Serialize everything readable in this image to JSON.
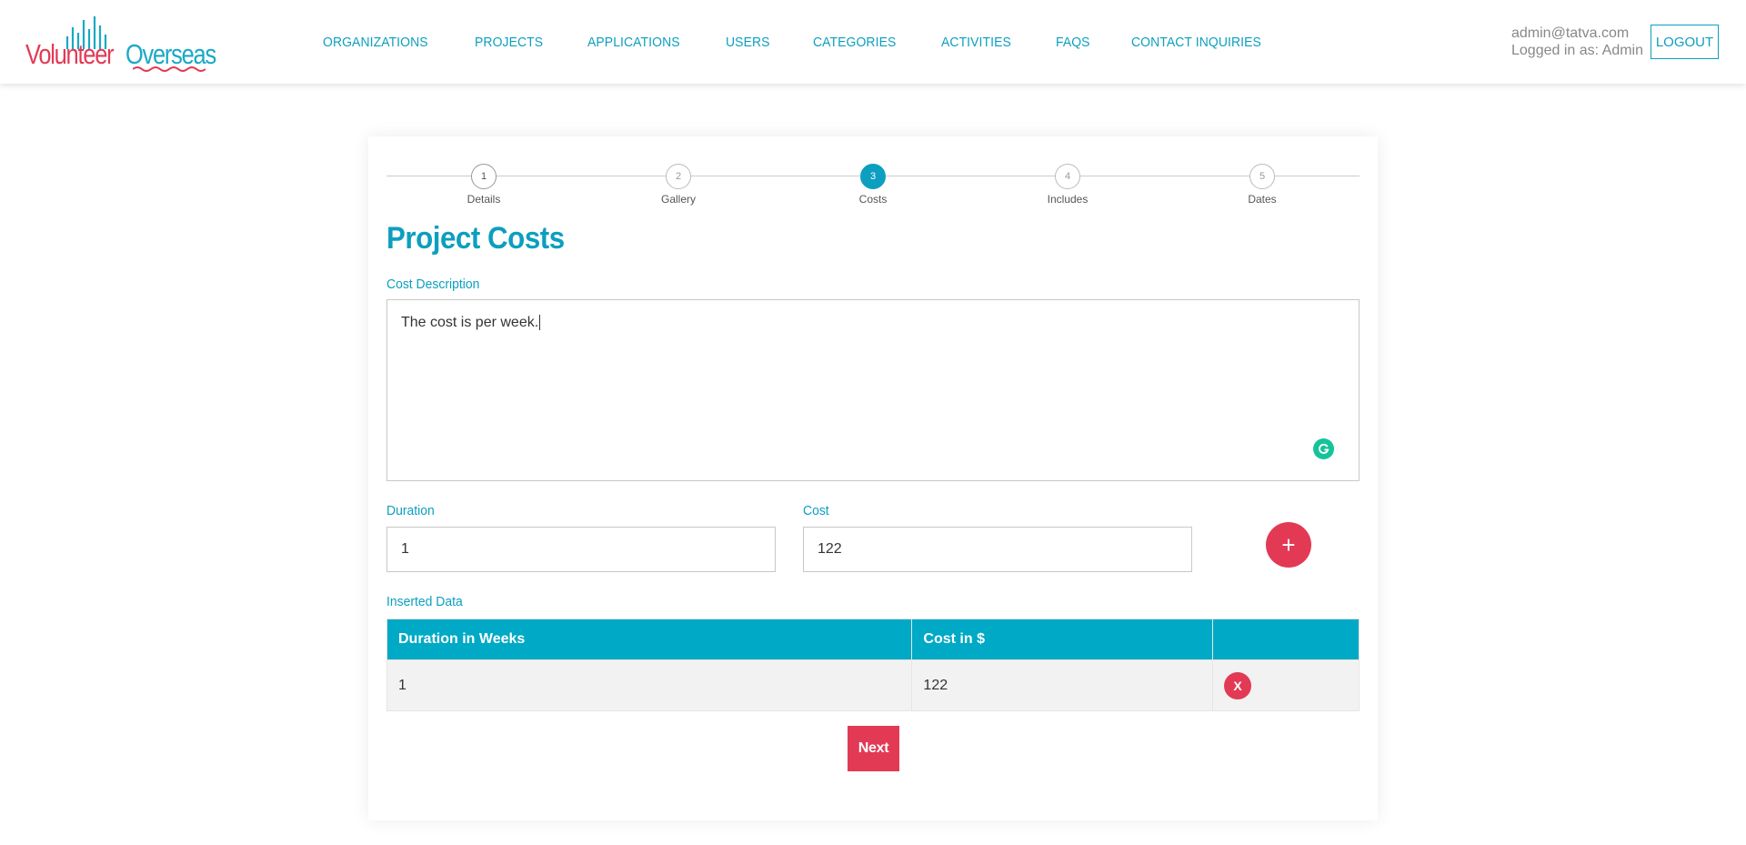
{
  "brand": {
    "name_part1": "Volunteer",
    "name_part2": "Overseas",
    "colors": {
      "primary": "#0c9fbf",
      "accent": "#e23a55",
      "header_table": "#00a9c5"
    }
  },
  "nav": {
    "items": [
      {
        "label": "ORGANIZATIONS"
      },
      {
        "label": "PROJECTS"
      },
      {
        "label": "APPLICATIONS"
      },
      {
        "label": "USERS"
      },
      {
        "label": "CATEGORIES"
      },
      {
        "label": "ACTIVITIES"
      },
      {
        "label": "FAQS"
      },
      {
        "label": "CONTACT INQUIRIES"
      }
    ]
  },
  "user": {
    "email": "admin@tatva.com",
    "role_text": "Logged in as: Admin",
    "logout_label": "LOGOUT"
  },
  "stepper": {
    "steps": [
      {
        "number": "1",
        "label": "Details",
        "state": "done"
      },
      {
        "number": "2",
        "label": "Gallery",
        "state": "upcoming"
      },
      {
        "number": "3",
        "label": "Costs",
        "state": "active"
      },
      {
        "number": "4",
        "label": "Includes",
        "state": "upcoming"
      },
      {
        "number": "5",
        "label": "Dates",
        "state": "upcoming"
      }
    ]
  },
  "form": {
    "title": "Project Costs",
    "cost_description_label": "Cost Description",
    "cost_description_value": "The cost is per week.",
    "duration_label": "Duration",
    "duration_value": "1",
    "cost_label": "Cost",
    "cost_value": "122",
    "add_label": "+",
    "inserted_label": "Inserted Data",
    "next_label": "Next"
  },
  "table": {
    "columns": [
      "Duration in Weeks",
      "Cost in $",
      ""
    ],
    "rows": [
      {
        "duration": "1",
        "cost": "122",
        "delete_label": "X"
      }
    ]
  }
}
